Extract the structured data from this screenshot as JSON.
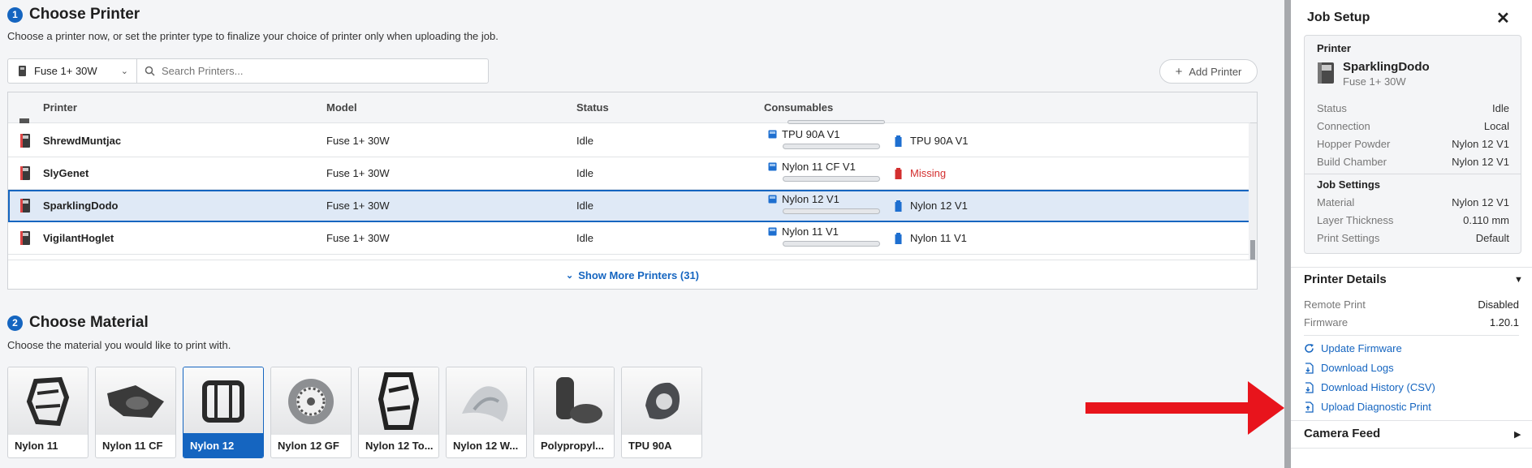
{
  "choose_printer": {
    "step": "1",
    "title": "Choose Printer",
    "subtitle": "Choose a printer now, or set the printer type to finalize your choice of printer only when uploading the job.",
    "printer_type": "Fuse 1+ 30W",
    "search_placeholder": "Search Printers...",
    "add_printer": "Add Printer",
    "columns": [
      "Printer",
      "Model",
      "Status",
      "Consumables"
    ],
    "rows": [
      {
        "name": "ShrewdMuntjac",
        "model": "Fuse 1+ 30W",
        "status": "Idle",
        "powder": "TPU 90A V1",
        "cartridge": "TPU 90A V1"
      },
      {
        "name": "SlyGenet",
        "model": "Fuse 1+ 30W",
        "status": "Idle",
        "powder": "Nylon 11 CF V1",
        "cartridge": "Missing"
      },
      {
        "name": "SparklingDodo",
        "model": "Fuse 1+ 30W",
        "status": "Idle",
        "powder": "Nylon 12 V1",
        "cartridge": "Nylon 12 V1"
      },
      {
        "name": "VigilantHoglet",
        "model": "Fuse 1+ 30W",
        "status": "Idle",
        "powder": "Nylon 11 V1",
        "cartridge": "Nylon 11 V1"
      }
    ],
    "show_more": "Show More Printers (31)"
  },
  "choose_material": {
    "step": "2",
    "title": "Choose Material",
    "subtitle": "Choose the material you would like to print with.",
    "materials": [
      {
        "label": "Nylon 11"
      },
      {
        "label": "Nylon 11 CF"
      },
      {
        "label": "Nylon 12"
      },
      {
        "label": "Nylon 12 GF"
      },
      {
        "label": "Nylon 12 To..."
      },
      {
        "label": "Nylon 12 W..."
      },
      {
        "label": "Polypropyl..."
      },
      {
        "label": "TPU 90A"
      }
    ],
    "selected": "Nylon 12"
  },
  "job_setup": {
    "title": "Job Setup",
    "printer_section": "Printer",
    "printer_name": "SparklingDodo",
    "printer_model": "Fuse 1+ 30W",
    "printer_kv": [
      {
        "k": "Status",
        "v": "Idle"
      },
      {
        "k": "Connection",
        "v": "Local"
      },
      {
        "k": "Hopper Powder",
        "v": "Nylon 12 V1"
      },
      {
        "k": "Build Chamber",
        "v": "Nylon 12 V1"
      }
    ],
    "job_section": "Job Settings",
    "job_kv": [
      {
        "k": "Material",
        "v": "Nylon 12 V1"
      },
      {
        "k": "Layer Thickness",
        "v": "0.110 mm"
      },
      {
        "k": "Print Settings",
        "v": "Default"
      }
    ],
    "details_title": "Printer Details",
    "details_kv": [
      {
        "k": "Remote Print",
        "v": "Disabled"
      },
      {
        "k": "Firmware",
        "v": "1.20.1"
      }
    ],
    "links": [
      "Update Firmware",
      "Download Logs",
      "Download History (CSV)",
      "Upload Diagnostic Print"
    ],
    "camera_title": "Camera Feed"
  },
  "colors": {
    "accent": "#1565c0",
    "missing": "#d32f2f",
    "arrow": "#e8141c"
  }
}
